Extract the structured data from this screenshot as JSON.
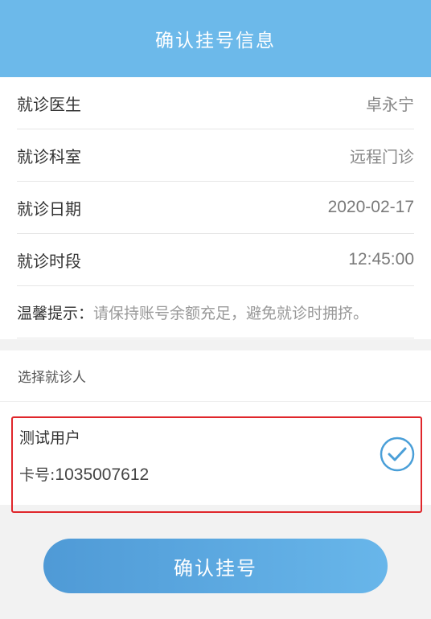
{
  "header": {
    "title": "确认挂号信息"
  },
  "info": {
    "rows": [
      {
        "label": "就诊医生",
        "value": "卓永宁"
      },
      {
        "label": "就诊科室",
        "value": "远程门诊"
      },
      {
        "label": "就诊日期",
        "value": "2020-02-17"
      },
      {
        "label": "就诊时段",
        "value": "12:45:00"
      }
    ],
    "tip_label": "温馨提示：",
    "tip_text": "请保持账号余额充足，避免就诊时拥挤。"
  },
  "patient_select": {
    "title": "选择就诊人",
    "patient": {
      "name": "测试用户",
      "card_prefix": "卡号:",
      "card_number": "1035007612",
      "selected_icon": "check-circle-icon"
    }
  },
  "confirm_button": {
    "label": "确认挂号"
  },
  "colors": {
    "header_bg": "#6cb9ea",
    "selection_border": "#e0262b",
    "check_icon": "#4a9fd8",
    "button_gradient_start": "#4f9ad6",
    "button_gradient_end": "#68b6ea"
  }
}
